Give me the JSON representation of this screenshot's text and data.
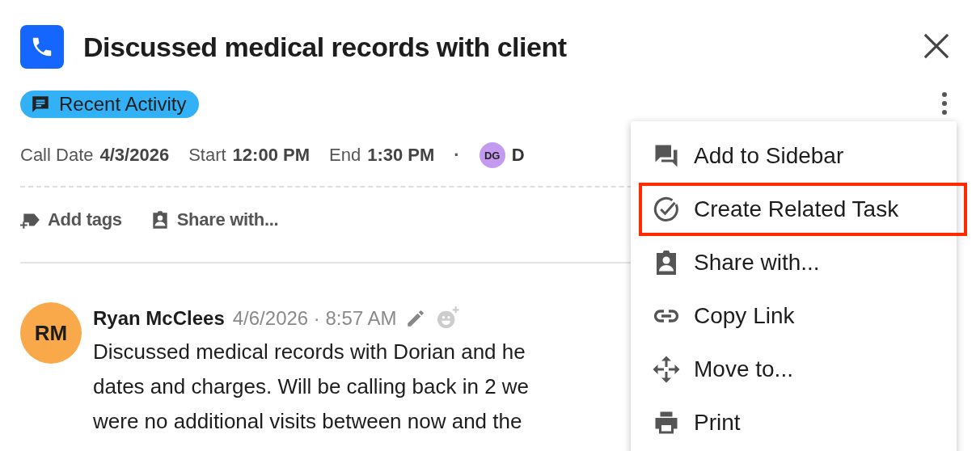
{
  "header": {
    "title": "Discussed medical records with client"
  },
  "tag": {
    "label": "Recent Activity"
  },
  "meta": [
    {
      "label": "Call Date",
      "value": "4/3/2026"
    },
    {
      "label": "Start",
      "value": "12:00 PM"
    },
    {
      "label": "End",
      "value": "1:30 PM"
    }
  ],
  "meta_separator": "·",
  "participant": {
    "initials": "DG",
    "name": "D"
  },
  "actions": [
    {
      "label": "Add tags",
      "kind": "tag"
    },
    {
      "label": "Share with...",
      "kind": "share"
    }
  ],
  "comment": {
    "initials": "RM",
    "author": "Ryan McClees",
    "date": "4/6/2026",
    "separator": "·",
    "time": "8:57 AM",
    "lines": [
      "Discussed medical records with Dorian and he",
      "dates and charges. Will be calling back in 2 we",
      "were no additional visits between now and the"
    ]
  },
  "menu": [
    {
      "label": "Add to Sidebar",
      "kind": "sidebar",
      "selected": false
    },
    {
      "label": "Create Related Task",
      "kind": "task",
      "selected": true
    },
    {
      "label": "Share with...",
      "kind": "share",
      "selected": false
    },
    {
      "label": "Copy Link",
      "kind": "link",
      "selected": false
    },
    {
      "label": "Move to...",
      "kind": "move",
      "selected": false
    },
    {
      "label": "Print",
      "kind": "print",
      "selected": false
    }
  ]
}
